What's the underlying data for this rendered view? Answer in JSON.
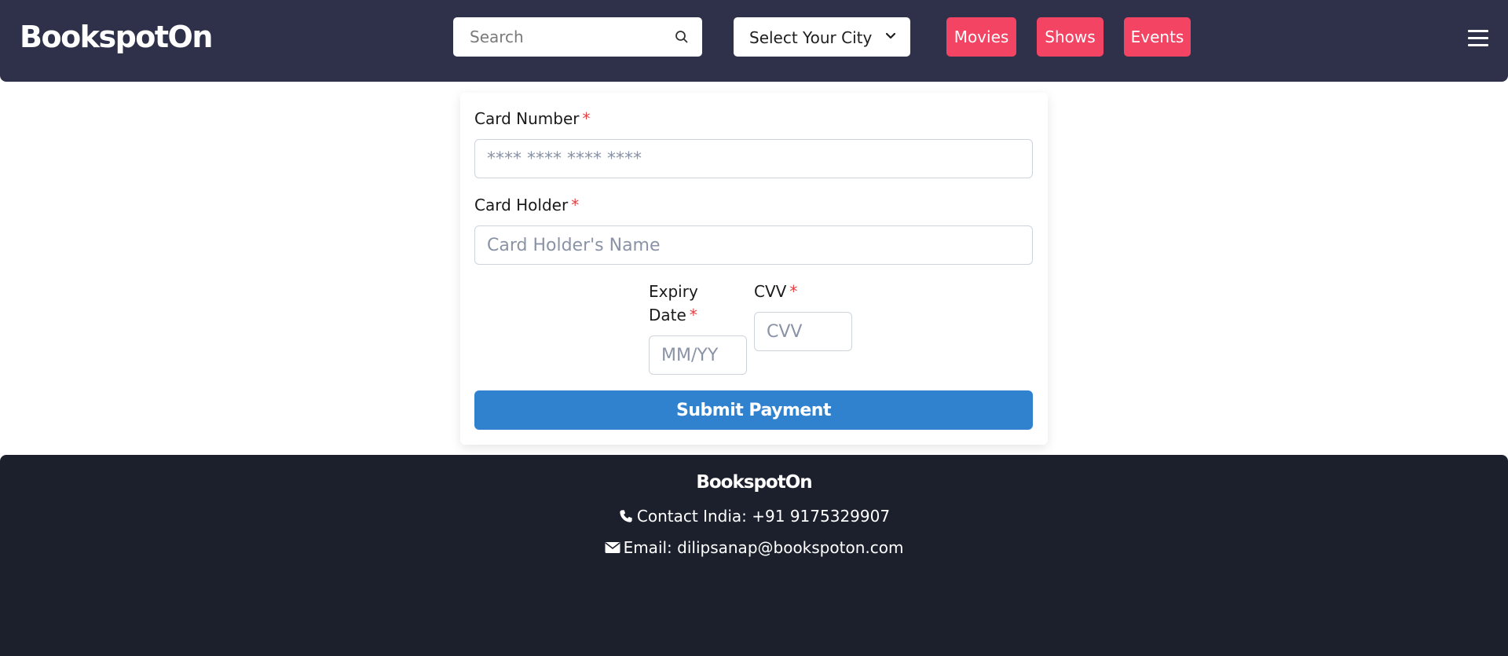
{
  "header": {
    "logo": "BookspotOn",
    "search": {
      "placeholder": "Search",
      "value": "",
      "icon": "search-icon"
    },
    "city_select": {
      "label": "Select Your City",
      "icon": "chevron-down-icon"
    },
    "nav": {
      "movies": "Movies",
      "shows": "Shows",
      "events": "Events"
    },
    "menu_icon": "hamburger-icon",
    "background_color": "#2e3149",
    "accent_color": "#f44463"
  },
  "payment_form": {
    "card_number": {
      "label": "Card Number",
      "required_mark": "*",
      "placeholder": "**** **** **** ****",
      "value": ""
    },
    "card_holder": {
      "label": "Card Holder",
      "required_mark": "*",
      "placeholder": "Card Holder's Name",
      "value": ""
    },
    "expiry_date": {
      "label": "Expiry Date",
      "required_mark": "*",
      "placeholder": "MM/YY",
      "value": ""
    },
    "cvv": {
      "label": "CVV",
      "required_mark": "*",
      "placeholder": "CVV",
      "value": ""
    },
    "submit_label": "Submit Payment",
    "submit_color": "#3182ce",
    "required_color": "#e53e3e"
  },
  "footer": {
    "brand": "BookspotOn",
    "contact": {
      "icon": "phone-icon",
      "text": "Contact India: +91 9175329907"
    },
    "email": {
      "icon": "envelope-icon",
      "text": "Email: dilipsanap@bookspoton.com"
    },
    "background_color": "#1c202d"
  }
}
